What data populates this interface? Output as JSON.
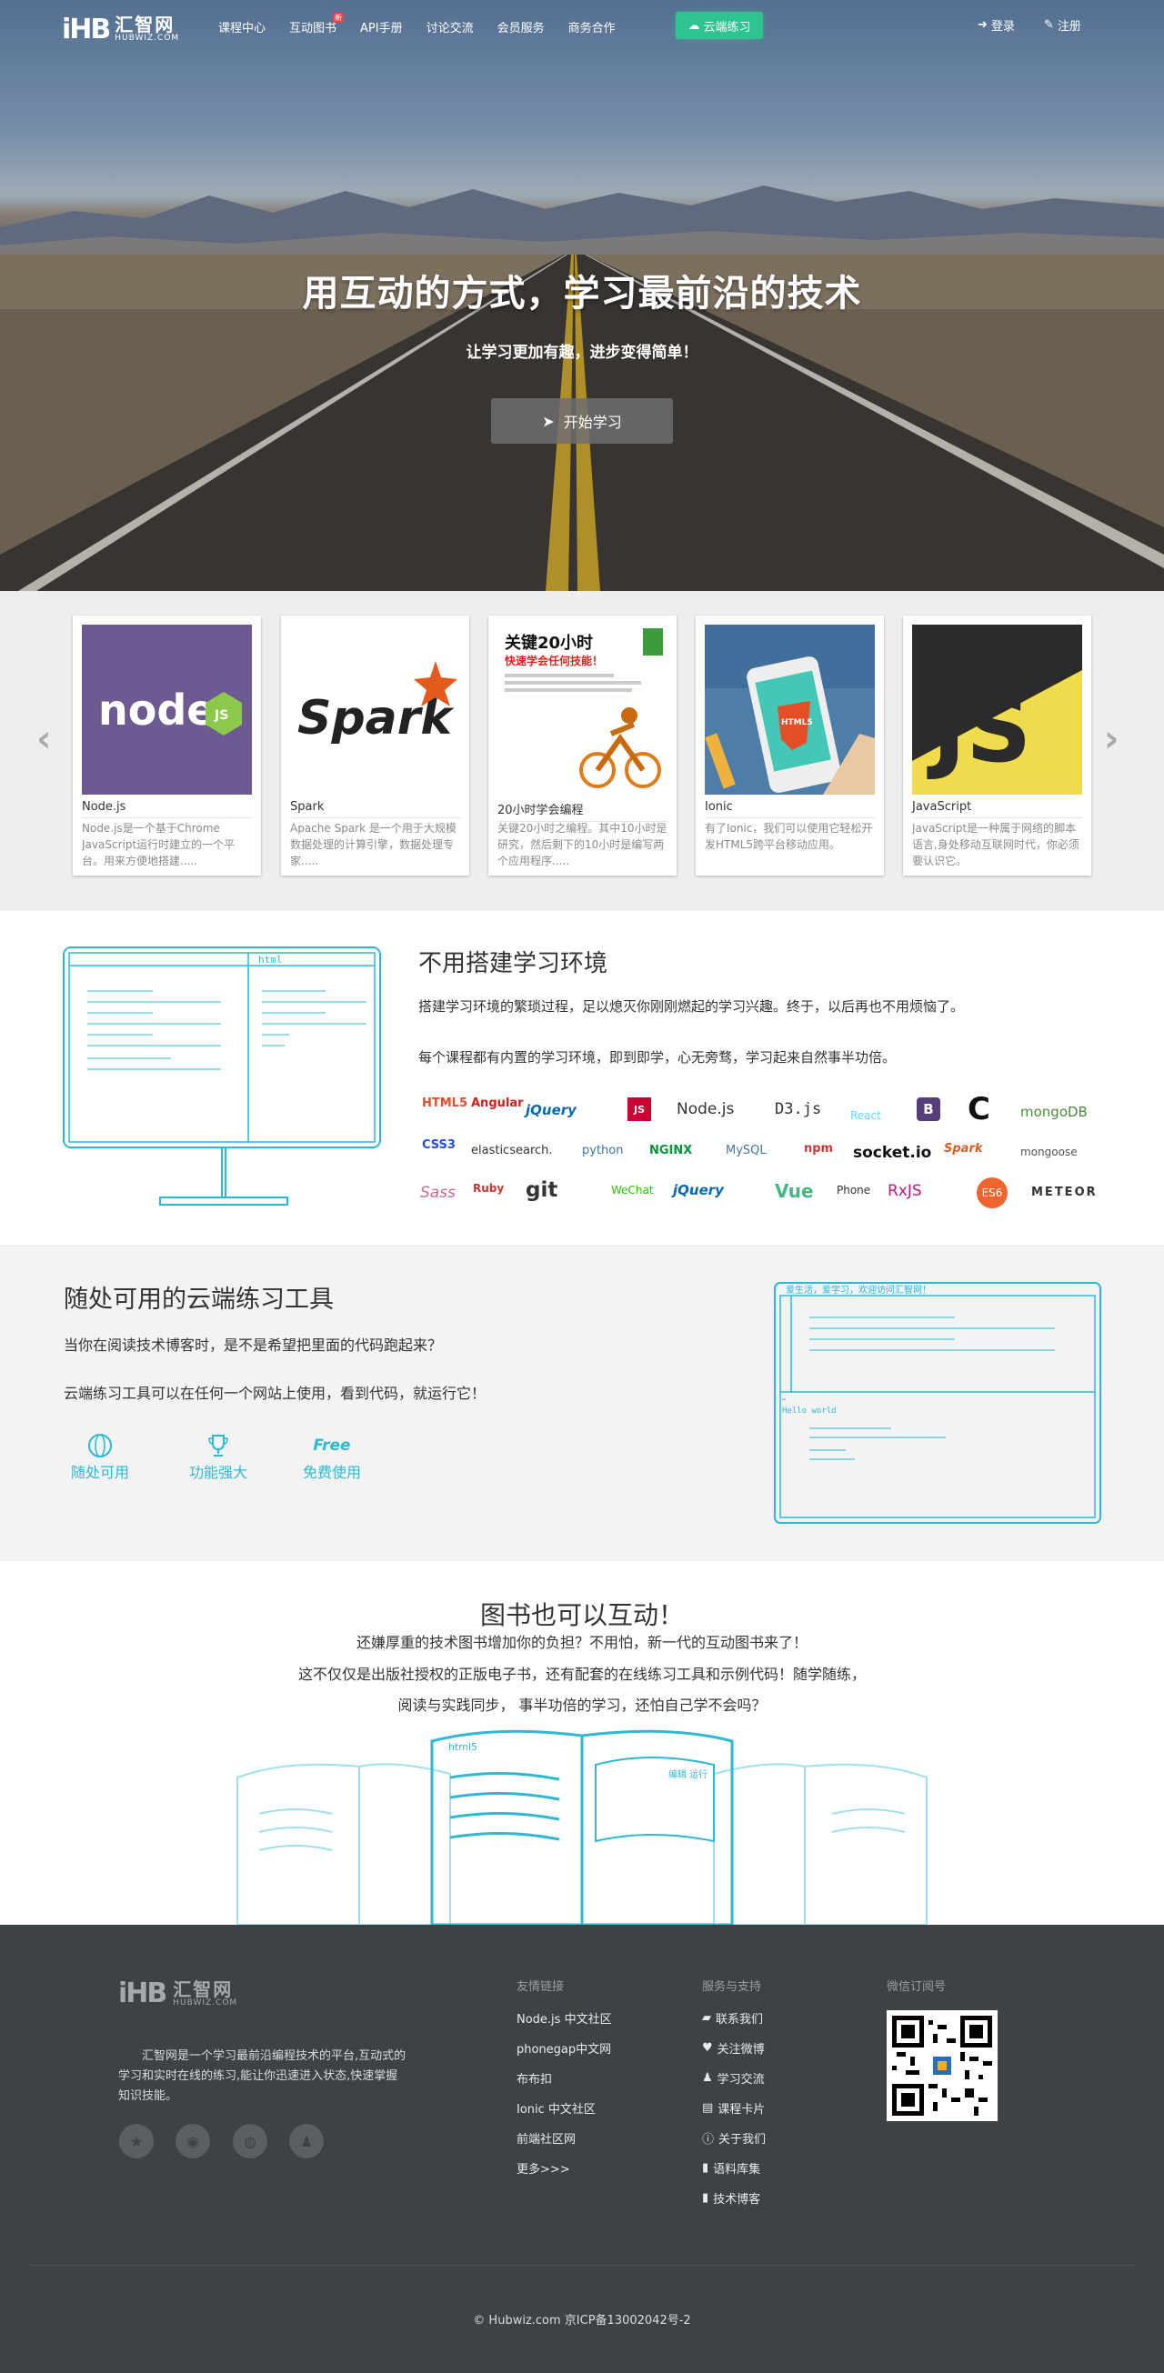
{
  "brand": {
    "cn": "汇智网",
    "en": "HUBWIZ.COM",
    "mark": "iHB"
  },
  "nav": {
    "items": [
      {
        "label": "课程中心"
      },
      {
        "label": "互动图书",
        "badge": "新"
      },
      {
        "label": "API手册"
      },
      {
        "label": "讨论交流"
      },
      {
        "label": "会员服务"
      },
      {
        "label": "商务合作"
      }
    ],
    "cloud_button": "云端练习",
    "login": "登录",
    "register": "注册"
  },
  "hero": {
    "title": "用互动的方式，学习最前沿的技术",
    "subtitle": "让学习更加有趣，进步变得简单！",
    "button": "开始学习"
  },
  "courses": {
    "items": [
      {
        "title": "Node.js",
        "desc": "Node.js是一个基于Chrome JavaScript运行时建立的一个平台。用来方便地搭建....."
      },
      {
        "title": "Spark",
        "desc": "Apache Spark 是一个用于大规模数据处理的计算引擎，数据处理专家....."
      },
      {
        "title": "20小时学会编程",
        "desc": "关键20小时之编程。其中10小时是研究，然后剩下的10小时是编写两个应用程序....."
      },
      {
        "title": "Ionic",
        "desc": "有了Ionic，我们可以使用它轻松开发HTML5跨平台移动应用。"
      },
      {
        "title": "JavaScript",
        "desc": "JavaScript是一种属于网络的脚本语言,身处移动互联网时代，你必须要认识它。"
      }
    ],
    "thumb_text": {
      "spark": "Spark",
      "node": "node",
      "book_title": "关键20小时",
      "book_sub": "快速学会任何技能！",
      "js": "JS",
      "html5": "HTML5"
    }
  },
  "env": {
    "title": "不用搭建学习环境",
    "p1": "搭建学习环境的繁琐过程，足以熄灭你刚刚燃起的学习兴趣。终于，以后再也不用烦恼了。",
    "p2": "每个课程都有内置的学习环境，即到即学，心无旁骛，学习起来自然事半功倍。",
    "monitor_label": "html",
    "techs": [
      "HTML5",
      "Angular",
      "jQuery",
      "JS",
      "Node.js",
      "D3.js",
      "React",
      "B",
      "C",
      "mongoDB",
      "CSS3",
      "elasticsearch.",
      "python",
      "NGINX",
      "MySQL",
      "npm",
      "socket.io",
      "Spark",
      "mongoose",
      "Sass",
      "Ruby",
      "git",
      "WeChat",
      "jQuery",
      "Vue",
      "Phone",
      "RxJS",
      "ES6",
      "METEOR"
    ]
  },
  "cloud": {
    "title": "随处可用的云端练习工具",
    "p1": "当你在阅读技术博客时，是不是希望把里面的代码跑起来？",
    "p2": "云端练习工具可以在任何一个网站上使用，看到代码，就运行它！",
    "features": [
      {
        "label": "随处可用",
        "icon": "globe-icon"
      },
      {
        "label": "功能强大",
        "icon": "trophy-icon"
      },
      {
        "label": "免费使用",
        "icon": "free-icon",
        "icon_text": "Free"
      }
    ],
    "window_banner": "爱生活，爱学习，欢迎访问汇智网！",
    "window_output": "Hello world"
  },
  "books": {
    "title": "图书也可以互动！",
    "lines": [
      "还嫌厚重的技术图书增加你的负担？不用怕，新一代的互动图书来了！",
      "这不仅仅是出版社授权的正版电子书，还有配套的在线练习工具和示例代码！随学随练，",
      "阅读与实践同步， 事半功倍的学习，还怕自己学不会吗？"
    ],
    "book_label": "html5",
    "edit_label": "编辑 运行"
  },
  "footer": {
    "intro": "汇智网是一个学习最前沿编程技术的平台,互动式的学习和实时在线的练习,能让你迅速进入状态,快速掌握知识技能。",
    "social_icons": [
      "star-icon",
      "weibo-icon",
      "wechat-icon",
      "user-icon"
    ],
    "friends": {
      "title": "友情链接",
      "links": [
        "Node.js 中文社区",
        "phonegap中文网",
        "布布扣",
        "Ionic 中文社区",
        "前端社区网",
        "更多>>>"
      ]
    },
    "support": {
      "title": "服务与支持",
      "links": [
        {
          "label": "联系我们",
          "icon": "comment-icon"
        },
        {
          "label": "关注微博",
          "icon": "heart-icon"
        },
        {
          "label": "学习交流",
          "icon": "user-icon"
        },
        {
          "label": "课程卡片",
          "icon": "card-icon"
        },
        {
          "label": "关于我们",
          "icon": "info-icon"
        },
        {
          "label": "语料库集",
          "icon": "file-icon"
        },
        {
          "label": "技术博客",
          "icon": "file-icon"
        }
      ]
    },
    "wechat": {
      "title": "微信订阅号"
    },
    "copyright": "© Hubwiz.com    京ICP备13002042号-2"
  },
  "colors": {
    "accent": "#2db9d4",
    "green": "#2fc38f",
    "footer_bg": "#3d4244"
  }
}
